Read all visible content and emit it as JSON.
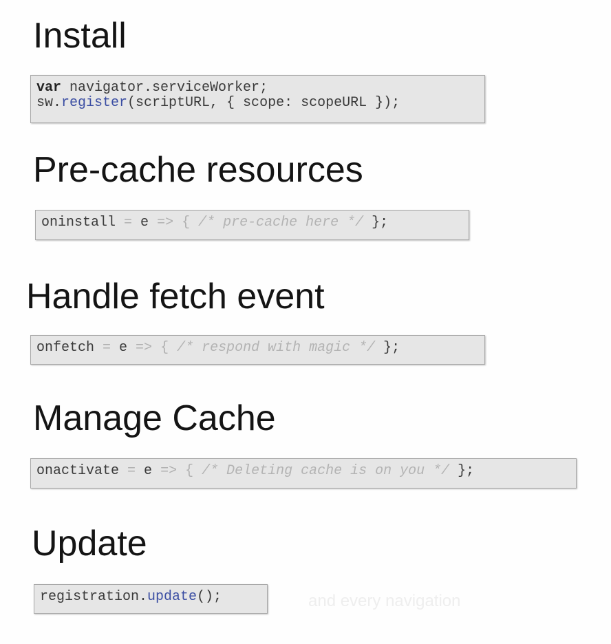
{
  "sections": [
    {
      "title": "Install",
      "code": {
        "line1": {
          "keyword": "var",
          "rest": " navigator.serviceWorker;"
        },
        "line2": {
          "prefix": "sw.",
          "fn": "register",
          "rest": "(scriptURL, { scope: scopeURL });"
        }
      }
    },
    {
      "title": "Pre-cache resources",
      "code": {
        "ident": "oninstall",
        "assign": " = ",
        "param": "e ",
        "arrow": "=>",
        "open": " { ",
        "comment": "/* pre-cache here */",
        "close": " };"
      }
    },
    {
      "title": "Handle fetch event",
      "code": {
        "ident": "onfetch",
        "assign": " = ",
        "param": "e ",
        "arrow": "=>",
        "open": " { ",
        "comment": "/* respond with magic */",
        "close": " };"
      }
    },
    {
      "title": "Manage Cache",
      "code": {
        "ident": "onactivate",
        "assign": " = ",
        "param": "e ",
        "arrow": "=>",
        "open": " { ",
        "comment": "/* Deleting cache is on you */",
        "close": " };"
      }
    },
    {
      "title": "Update",
      "code": {
        "prefix": "registration.",
        "fn": "update",
        "rest": "();"
      },
      "note": "and every navigation"
    }
  ],
  "colors": {
    "keyword": "#222222",
    "function": "#3b4ea3",
    "comment": "#b3b3b3",
    "code_background": "#e6e6e6"
  }
}
